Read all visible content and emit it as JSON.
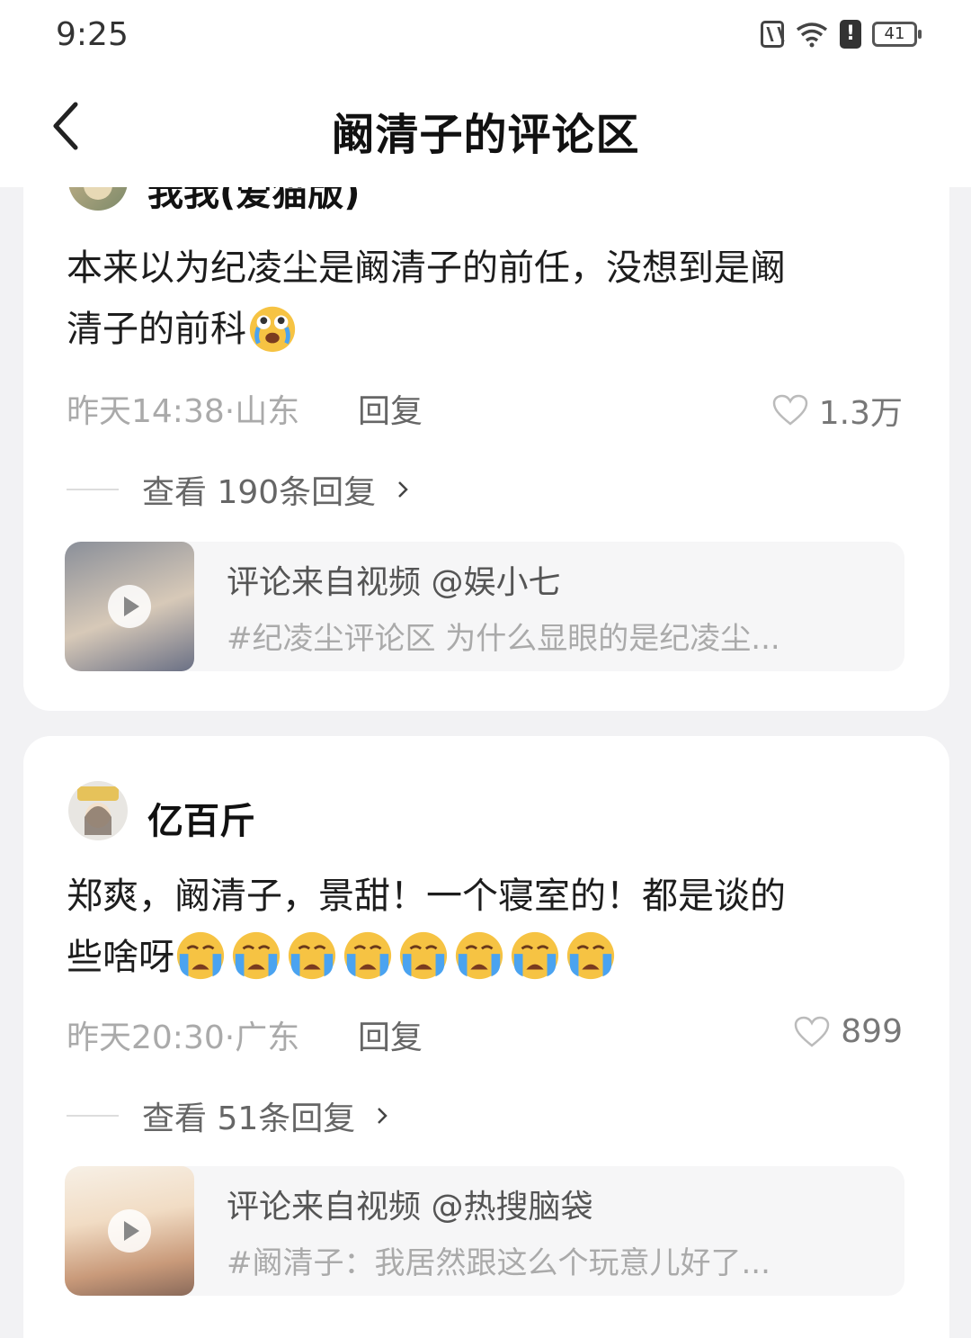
{
  "status_bar": {
    "time": "9:25",
    "battery": "41"
  },
  "header": {
    "title": "阚清子的评论区"
  },
  "comments": [
    {
      "username": "我我(爱猫版)",
      "text_line1": "本来以为纪凌尘是阚清子的前任，没想到是阚",
      "text_line2": "清子的前科",
      "emoji": "laugh-cry-emoji",
      "meta": "昨天14:38·山东",
      "reply_label": "回复",
      "likes": "1.3万",
      "view_replies": "查看 190条回复",
      "source_title": "评论来自视频 @娱小七",
      "source_desc": "#纪凌尘评论区 为什么显眼的是纪凌尘..."
    },
    {
      "username": "亿百斤",
      "text_line1": "郑爽，阚清子，景甜！一个寝室的！都是谈的",
      "text_line2": "些啥呀",
      "emoji": "crying-emoji",
      "emoji_count": 8,
      "meta": "昨天20:30·广东",
      "reply_label": "回复",
      "likes": "899",
      "view_replies": "查看 51条回复",
      "source_title": "评论来自视频 @热搜脑袋",
      "source_desc": "#阚清子：我居然跟这么个玩意儿好了..."
    }
  ],
  "colors": {
    "background": "#f2f2f4",
    "card": "#ffffff",
    "meta": "#aaaaaa",
    "emoji": "#f6c343"
  }
}
